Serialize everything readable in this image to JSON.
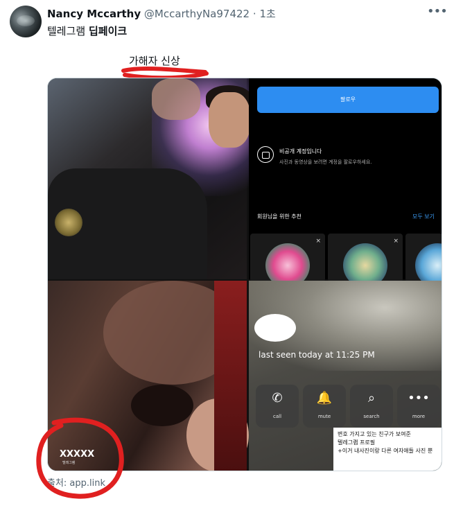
{
  "tweet": {
    "display_name": "Nancy Mccarthy",
    "handle": "@MccarthyNa97422",
    "separator": "·",
    "time": "1초",
    "more_icon": "more-horizontal-icon",
    "text_plain": "텔레그램 ",
    "text_bold": "딥페이크"
  },
  "annotation": {
    "text": "가해자 신상",
    "color": "#e02020"
  },
  "image": {
    "top_right": {
      "follow_label": "팔로우",
      "private_title": "비공개 계정입니다",
      "private_subtitle": "사진과 동영상을 보려면 계정을 팔로우하세요.",
      "suggest_title": "회원님을 위한 추천",
      "see_all": "모두 보기",
      "close_glyph": "×"
    },
    "bottom_right": {
      "last_seen": "last seen today at 11:25 PM",
      "actions": [
        {
          "label": "call",
          "icon": "phone-icon",
          "glyph": "✆"
        },
        {
          "label": "mute",
          "icon": "bell-icon",
          "glyph": "🔔"
        },
        {
          "label": "search",
          "icon": "search-icon",
          "glyph": "⌕"
        },
        {
          "label": "more",
          "icon": "more-icon",
          "glyph": "•••"
        }
      ],
      "caption_lines": [
        "변호 가지고 있는 친구가 보여준",
        "텔레그램 프로필",
        "+이거 내사진이랑 다른 여자애들 사진 뿐"
      ]
    },
    "watermark": "XXXXX",
    "watermark_sub": "텔레그램"
  },
  "source": {
    "label": "출처: app.link"
  },
  "colors": {
    "link_blue": "#2d8df1",
    "secondary_text": "#536471",
    "marker_red": "#e02020"
  }
}
